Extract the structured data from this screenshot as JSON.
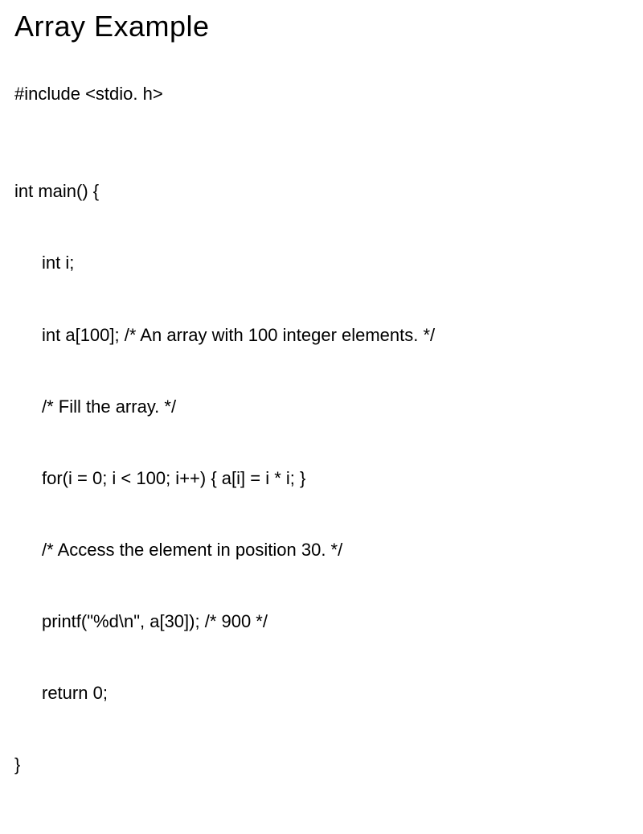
{
  "title": "Array Example",
  "include_line": "#include <stdio. h>",
  "code": {
    "l1": "int main() {",
    "l2": "int i;",
    "l3": "int a[100]; /* An array with 100 integer elements. */",
    "l4": "/* Fill the array. */",
    "l5": "for(i = 0; i < 100; i++) { a[i] = i * i; }",
    "l6": "/* Access the element in position 30. */",
    "l7": "printf(\"%d\\n\", a[30]); /* 900 */",
    "l8": "return 0;",
    "l9": "}"
  }
}
